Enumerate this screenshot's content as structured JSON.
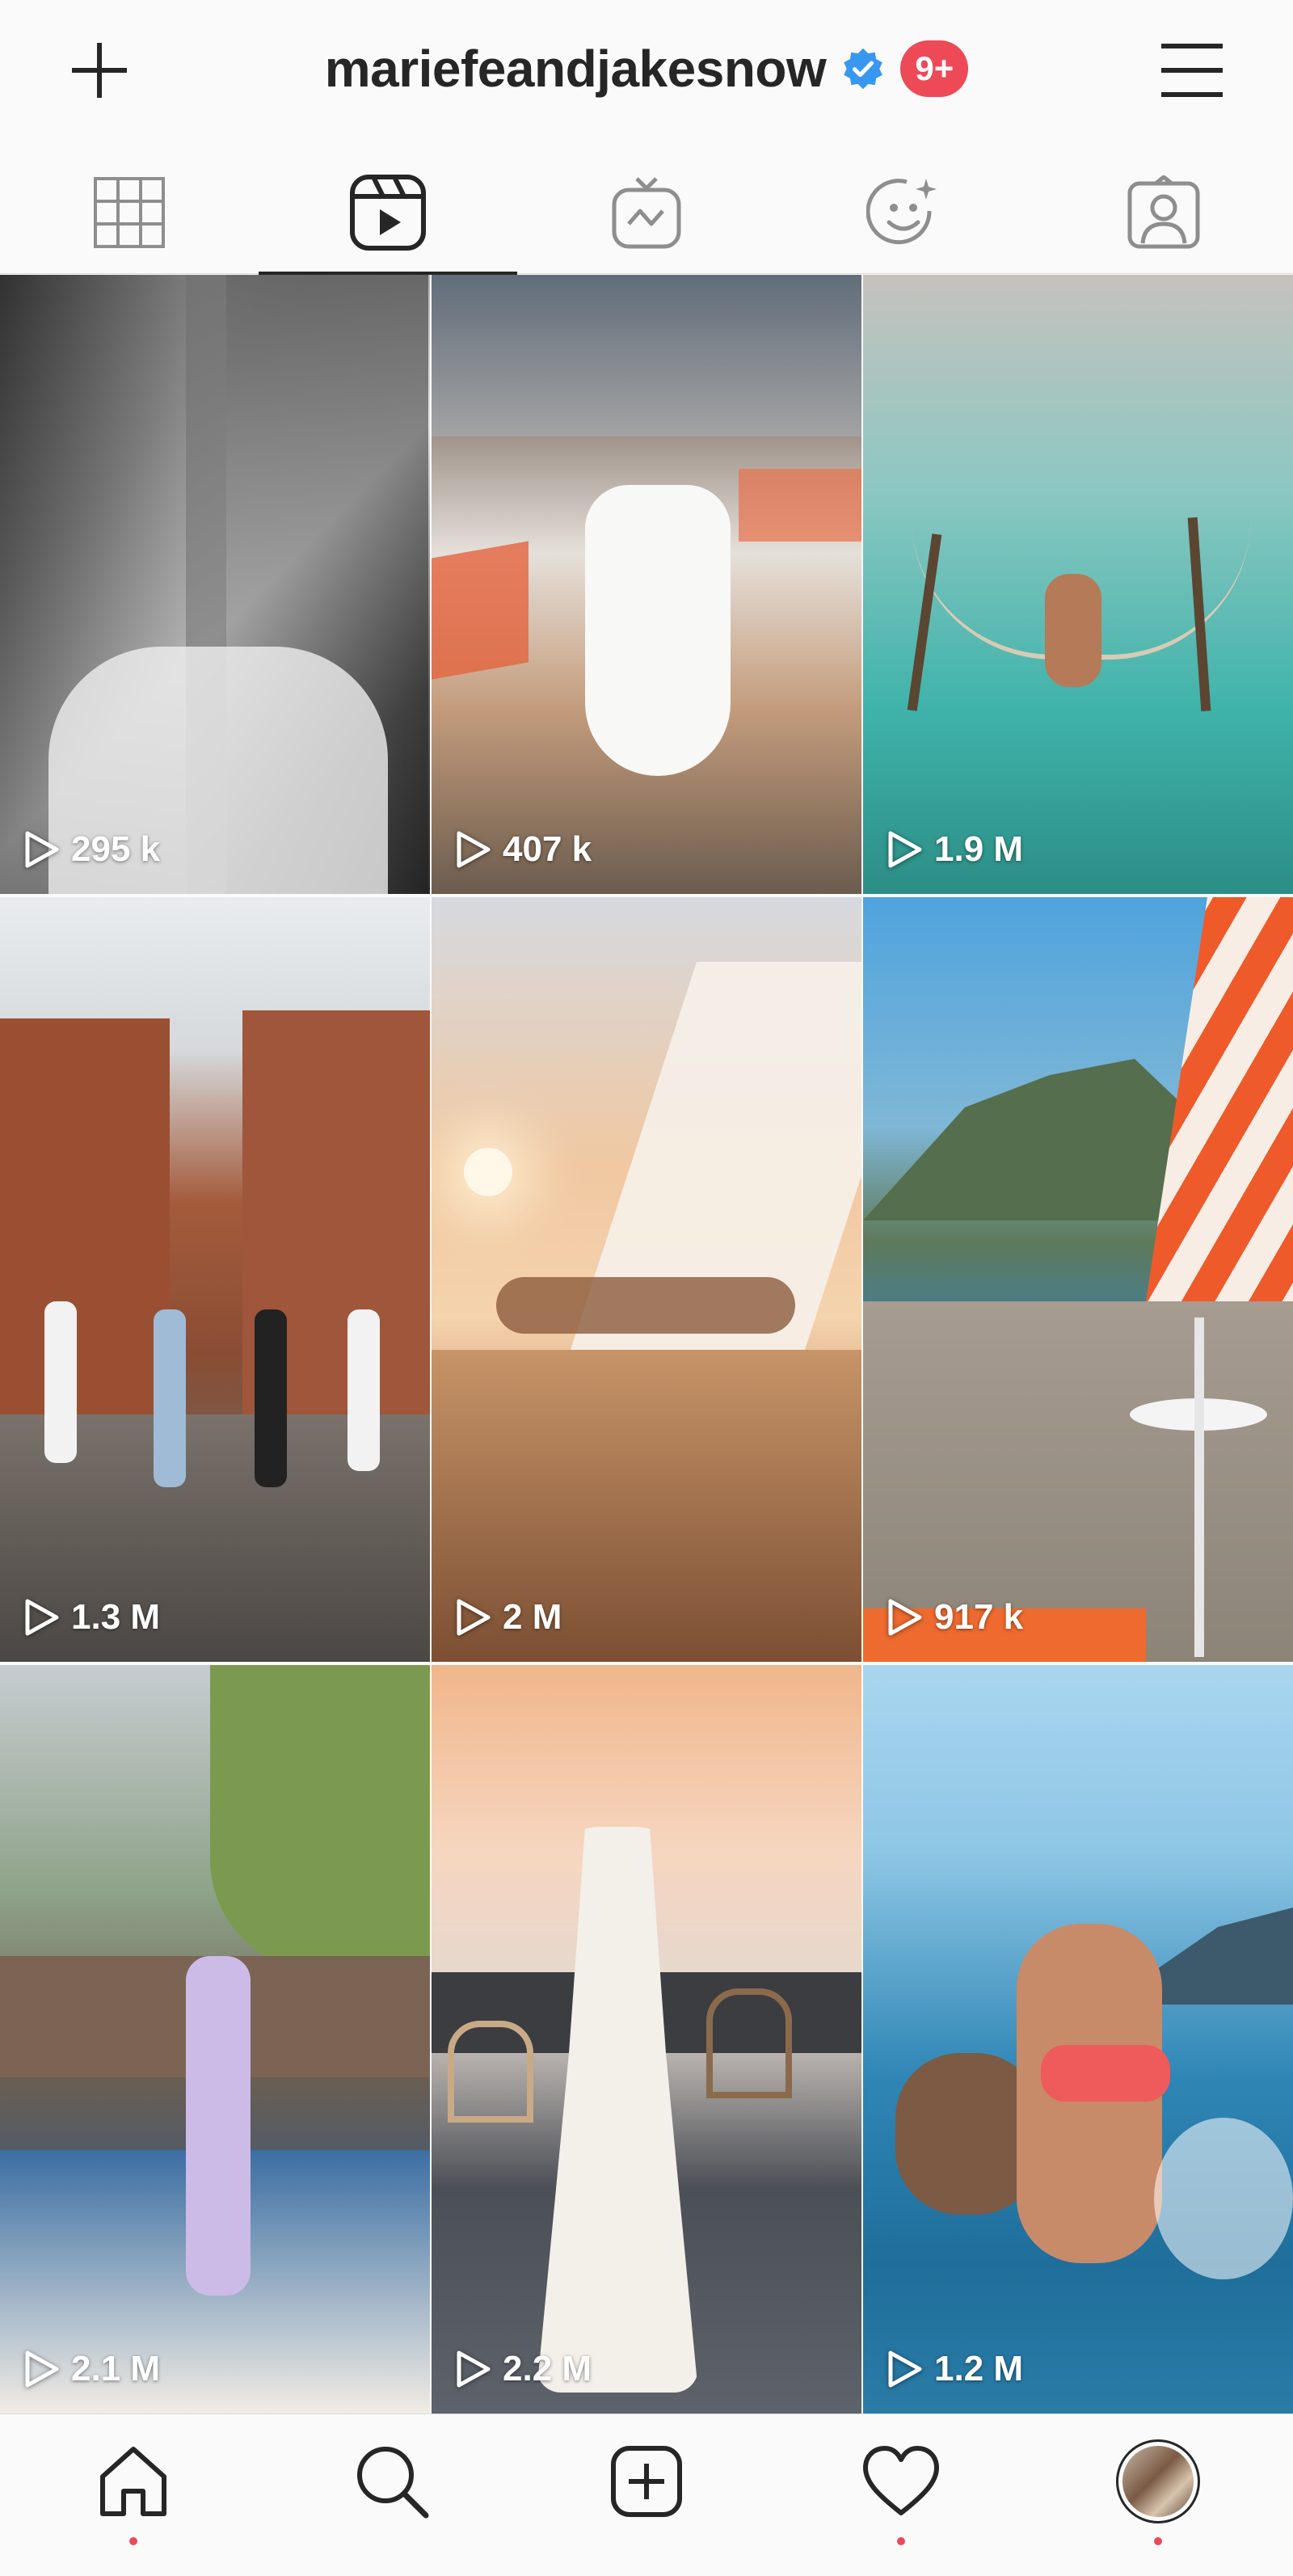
{
  "header": {
    "username": "mariefeandjakesnow",
    "notification_badge": "9+",
    "colors": {
      "badge": "#ed4956",
      "verified": "#3897f0"
    }
  },
  "tabs": [
    {
      "name": "grid",
      "icon": "grid-icon",
      "active": false
    },
    {
      "name": "reels",
      "icon": "reels-icon",
      "active": true
    },
    {
      "name": "igtv",
      "icon": "igtv-icon",
      "active": false
    },
    {
      "name": "effects",
      "icon": "effects-icon",
      "active": false
    },
    {
      "name": "tagged",
      "icon": "tagged-icon",
      "active": false
    }
  ],
  "reels": [
    {
      "views": "295 k"
    },
    {
      "views": "407 k"
    },
    {
      "views": "1.9 M"
    },
    {
      "views": "1.3 M"
    },
    {
      "views": "2 M"
    },
    {
      "views": "917 k"
    },
    {
      "views": "2.1 M"
    },
    {
      "views": "2.2 M"
    },
    {
      "views": "1.2 M"
    }
  ],
  "bottom_nav": [
    {
      "icon": "home-icon",
      "notification_dot": true
    },
    {
      "icon": "search-icon",
      "notification_dot": false
    },
    {
      "icon": "new-post-icon",
      "notification_dot": false
    },
    {
      "icon": "activity-heart-icon",
      "notification_dot": true
    },
    {
      "icon": "profile-avatar",
      "notification_dot": true
    }
  ]
}
